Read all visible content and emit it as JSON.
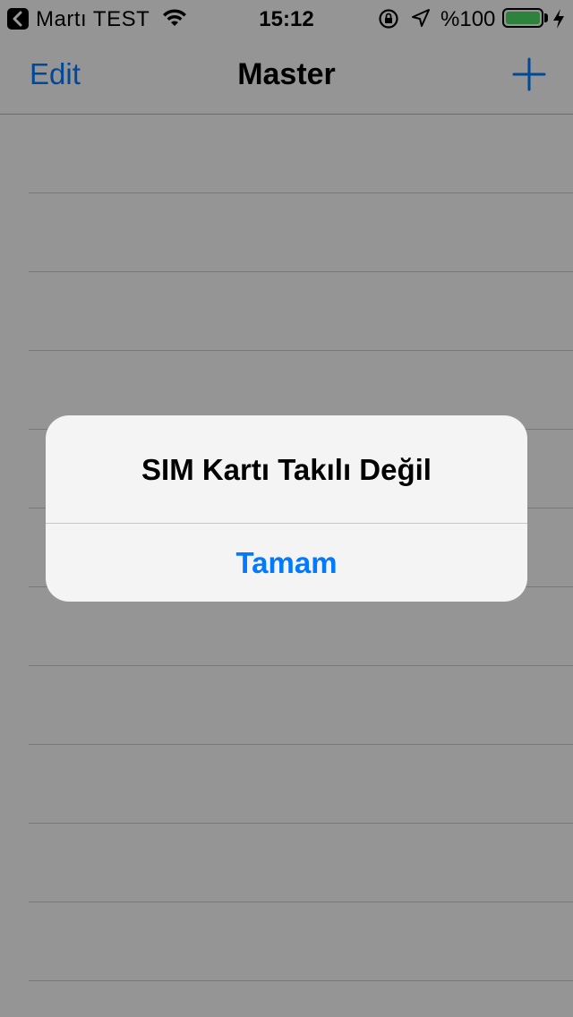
{
  "status_bar": {
    "carrier": "Martı TEST",
    "time": "15:12",
    "battery_percent": "%100",
    "battery_level": 1.0,
    "icons": [
      "back-to-app-icon",
      "wifi-icon",
      "rotation-lock-icon",
      "location-arrow-icon",
      "battery-icon",
      "charging-bolt-icon"
    ]
  },
  "nav_bar": {
    "edit_label": "Edit",
    "title": "Master",
    "add_icon": "plus-icon"
  },
  "alert": {
    "title": "SIM Kartı Takılı Değil",
    "button_label": "Tamam"
  },
  "colors": {
    "accent": "#007aff",
    "battery": "#4cd964",
    "alert_background": "#f4f4f4"
  }
}
